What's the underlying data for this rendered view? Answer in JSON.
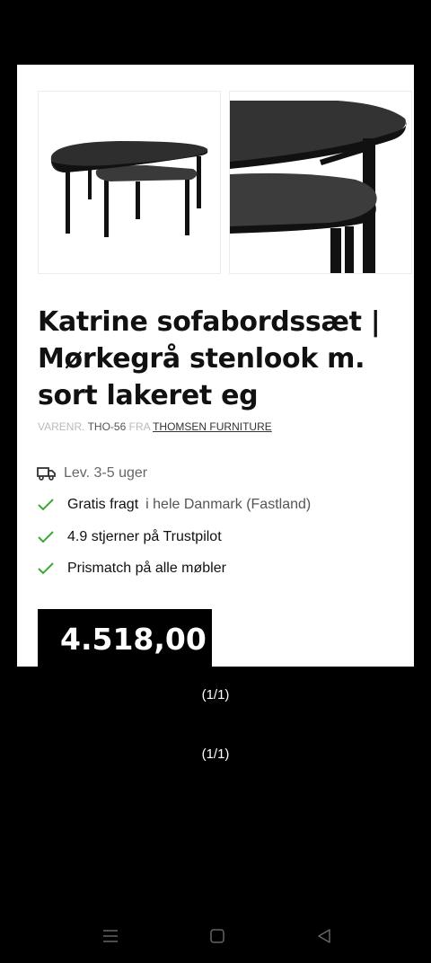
{
  "product": {
    "title": "Katrine sofabordssæt | Mørkegrå stenlook m. sort lakeret eg",
    "sku_label": "VARENR.",
    "sku": "THO-56",
    "from_label": "FRA",
    "brand": "THOMSEN FURNITURE",
    "price": "4.518,00"
  },
  "features": {
    "delivery": "Lev. 3-5 uger",
    "shipping_bold": "Gratis fragt",
    "shipping_rest": "i hele Danmark (Fastland)",
    "rating": "4.9 stjerner på Trustpilot",
    "pricematch": "Prismatch på alle møbler"
  },
  "gallery": {
    "counter_1": "(1/1)",
    "counter_2": "(1/1)"
  },
  "colors": {
    "check_green": "#3aaa35",
    "price_bg": "#000000"
  },
  "icons": [
    "truck-icon",
    "check-icon",
    "menu-icon",
    "home-icon",
    "back-icon"
  ]
}
